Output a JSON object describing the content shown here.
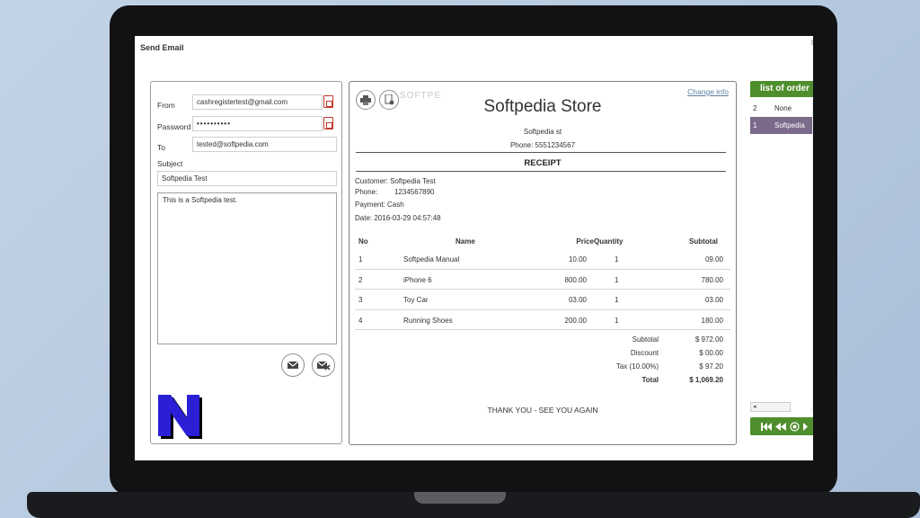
{
  "window": {
    "title": "Send Email"
  },
  "email_form": {
    "from_label": "From",
    "from_value": "cashregistertest@gmail.com",
    "password_label": "Password",
    "password_value": "••••••••••",
    "to_label": "To",
    "to_value": "tested@softpedia.com",
    "subject_label": "Subject",
    "subject_value": "Softpedia Test",
    "body_value": "This is a Softpedia test."
  },
  "receipt": {
    "change_info": "Change info",
    "watermark": "SOFTPE",
    "store_name": "Softpedia Store",
    "store_address": "Softpedia st",
    "store_phone": "Phone: 5551234567",
    "title": "RECEIPT",
    "customer": "Customer: Softpedia Test",
    "phone_label": "Phone:",
    "phone_value": "1234567890",
    "payment": "Payment: Cash",
    "date": "Date: 2016-03-29 04:57:48",
    "columns": [
      "No",
      "Name",
      "Price",
      "Quantity",
      "Subtotal"
    ],
    "items": [
      {
        "no": "1",
        "name": "Softpedia Manual",
        "price": "10.00",
        "qty": "1",
        "subtotal": "09.00"
      },
      {
        "no": "2",
        "name": "iPhone 6",
        "price": "800.00",
        "qty": "1",
        "subtotal": "780.00"
      },
      {
        "no": "3",
        "name": "Toy Car",
        "price": "03.00",
        "qty": "1",
        "subtotal": "03.00"
      },
      {
        "no": "4",
        "name": "Running Shoes",
        "price": "200.00",
        "qty": "1",
        "subtotal": "180.00"
      }
    ],
    "totals": {
      "subtotal_label": "Subtotal",
      "subtotal_value": "$ 972.00",
      "discount_label": "Discount",
      "discount_value": "$ 00.00",
      "tax_label": "Tax (10.00%)",
      "tax_value": "$ 97.20",
      "total_label": "Total",
      "total_value": "$ 1,069.20"
    },
    "thanks": "THANK YOU - SEE YOU AGAIN"
  },
  "orders": {
    "header": "list of order",
    "rows": [
      {
        "id": "2",
        "name": "None"
      },
      {
        "id": "1",
        "name": "Softpedia"
      }
    ],
    "scroll_arrow": "◂"
  },
  "icons": {
    "logo": "N"
  },
  "colors": {
    "accent_green": "#4f8e2c",
    "selected_row": "#7b6a8a",
    "link": "#5d7fa3",
    "pdf_red": "#c0392b",
    "logo_blue": "#2b1fd6"
  }
}
